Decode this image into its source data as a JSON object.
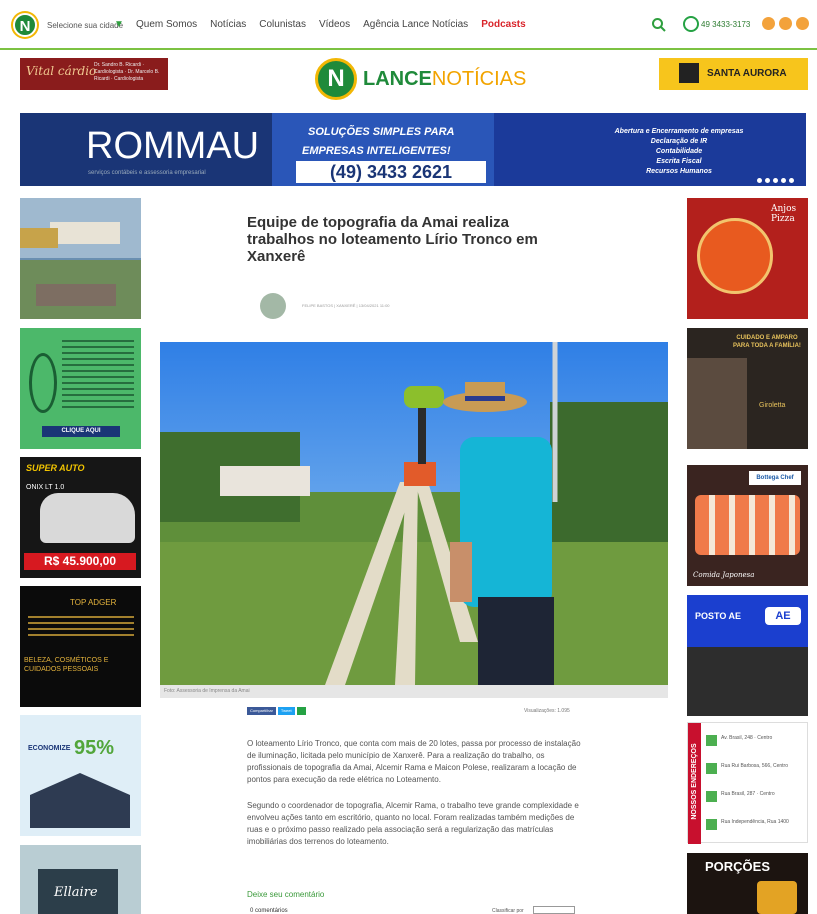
{
  "nav": {
    "brand_initial": "N",
    "city_label": "Selecione sua cidade",
    "menu": [
      "Quem Somos",
      "Notícias",
      "Colunistas",
      "Vídeos",
      "Agência Lance Notícias",
      "Podcasts"
    ],
    "phone": "49 3433-3173",
    "accent": "#7cc242"
  },
  "header": {
    "brand_initial": "N",
    "brand_lance": "LANCE",
    "brand_noticias": "NOTÍCIAS",
    "ad_left_name": "Vital cárdio",
    "ad_left_sub": "Dr. Sandro B. Ricardi · Cardiologista · Dr. Marcelo B. Ricardi · Cardiologista",
    "ad_right_name": "SANTA AURORA"
  },
  "banner": {
    "brand": "ROMMAU",
    "brand_sub": "serviços contábeis e assessoria empresarial",
    "line1": "SOLUÇÕES SIMPLES PARA",
    "line2": "EMPRESAS INTELIGENTES!",
    "phone": "(49) 3433 2621",
    "services": [
      "Abertura e Encerramento de empresas",
      "Declaração de IR",
      "Contabilidade",
      "Escrita Fiscal",
      "Recursos Humanos"
    ]
  },
  "left_ads": {
    "ad2_button": "CLIQUE AQUI",
    "ad3_brand": "SUPER AUTO",
    "ad3_model": "ONIX LT 1.0",
    "ad3_price": "R$ 45.900,00",
    "ad4_brand": "TOP ADGER",
    "ad4_tag": "BELEZA, COSMÉTICOS E CUIDADOS PESSOAIS",
    "ad5_line": "ECONOMIZE",
    "ad5_pct": "95%",
    "ad6_name": "Ellaire"
  },
  "right_ads": {
    "ad1_name": "Anjos Pizza",
    "ad2_tagline": "CUIDADO E AMPARO PARA TODA A FAMÍLIA!",
    "ad2_name": "Giroletta",
    "ad3_name": "Bottega Chef",
    "ad3_caption": "Comida Japonesa",
    "ad4_name": "POSTO AE",
    "enderecos_title": "NOSSOS ENDEREÇOS",
    "enderecos": [
      "Av. Brasil, 248 · Centro",
      "Rua Rui Barbosa, 566, Centro",
      "Rua Brasil, 287 · Centro",
      "Rua Independência, Rua 1400"
    ],
    "ad6_name": "PORÇÕES"
  },
  "article": {
    "title": "Equipe de topografia da Amai realiza trabalhos no loteamento Lírio Tronco em Xanxerê",
    "byline": "FELIPE BASTOS | XANXERÊ | 13/04/2021 11:00",
    "caption": "Foto: Assessoria de Imprensa da Amai",
    "share_facebook": "Compartilhar",
    "share_twitter": "Tweet",
    "views": "Visualizações: 1.095",
    "paragraphs": [
      "O loteamento Lírio Tronco, que conta com mais de 20 lotes, passa por processo de instalação de iluminação, licitada pelo município de Xanxerê. Para a realização do trabalho, os profissionais de topografia da Amai, Alcemir Rama e Maicon Polese, realizaram a locação de pontos para execução da rede elétrica no Loteamento.",
      "Segundo o coordenador de topografia, Alcemir Rama, o trabalho teve grande complexidade e envolveu ações tanto em escritório, quanto no local. Foram realizadas também medições de ruas e o próximo passo realizado pela associação será a regularização das matrículas imobiliárias dos terrenos do loteamento."
    ],
    "comment_title": "Deixe seu comentário",
    "comment_sub": "0 comentários",
    "comment_sort": "Classificar por"
  }
}
